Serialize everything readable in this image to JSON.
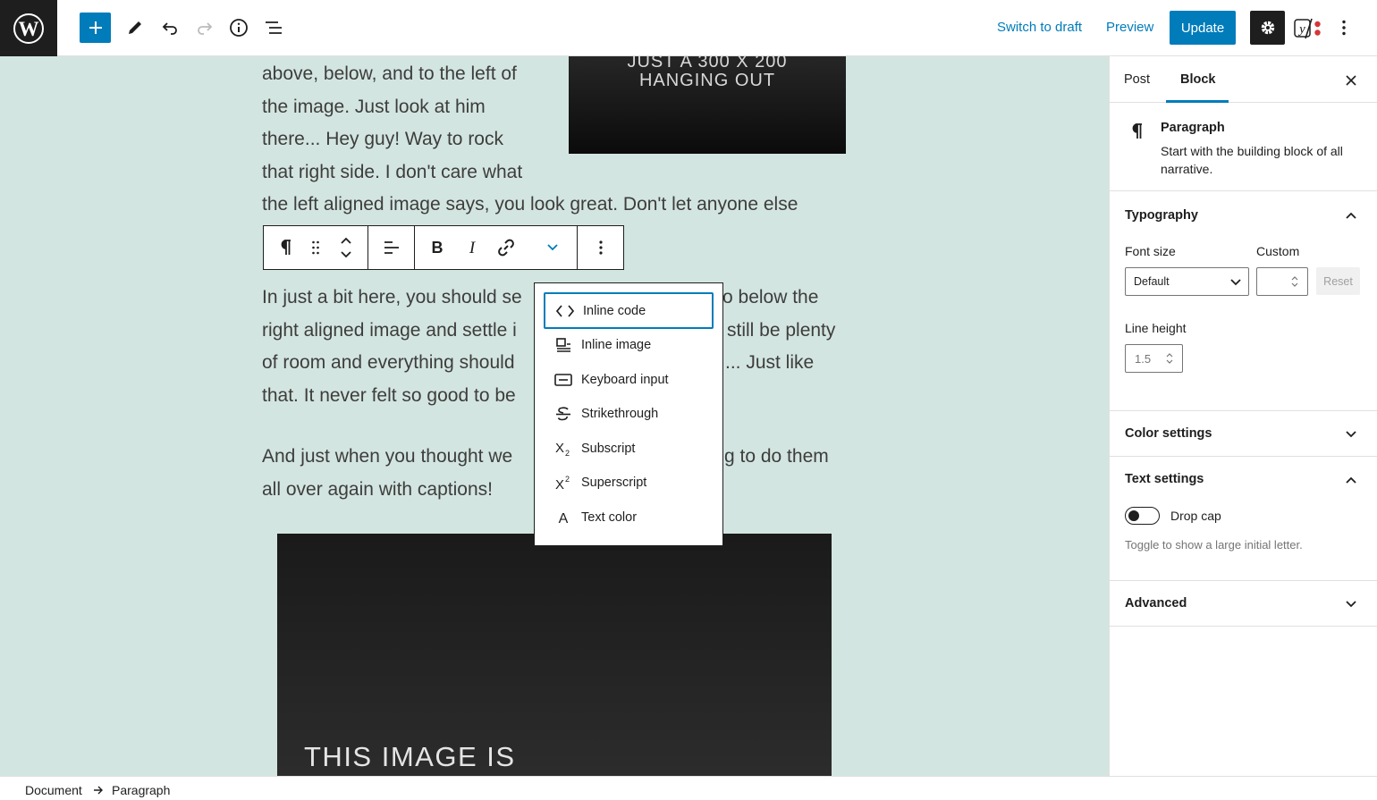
{
  "topbar": {
    "switch_to_draft": "Switch to draft",
    "preview": "Preview",
    "update": "Update",
    "yoast_letter": "y"
  },
  "content": {
    "lines_left_wrap": [
      "above, below, and to the left of",
      "the image. Just look at him",
      "there... Hey guy! Way to rock",
      "that right side. I don't care what"
    ],
    "line_full": "the left aligned image says, you look great. Don't let anyone else",
    "para2_left": [
      "In just a bit here, you should se",
      "right aligned image and settle i",
      "of room and everything should",
      "that. It never felt so good to be"
    ],
    "para2_right": [
      "o below the",
      "still be plenty",
      "... Just like",
      ""
    ],
    "para3_left": [
      "And just when you thought we",
      "all over again with captions!"
    ],
    "para3_right": [
      "g to do them",
      ""
    ],
    "image_top_caption_line1": "JUST A 300 X 200",
    "image_top_caption_line2": "HANGING OUT",
    "image_bottom_caption": "THIS IMAGE IS"
  },
  "format_menu": {
    "items": [
      {
        "label": "Inline code",
        "icon": "code-icon"
      },
      {
        "label": "Inline image",
        "icon": "inline-image-icon"
      },
      {
        "label": "Keyboard input",
        "icon": "keyboard-icon"
      },
      {
        "label": "Strikethrough",
        "icon": "strikethrough-icon"
      },
      {
        "label": "Subscript",
        "icon": "subscript-icon"
      },
      {
        "label": "Superscript",
        "icon": "superscript-icon"
      },
      {
        "label": "Text color",
        "icon": "text-color-icon"
      }
    ],
    "active_index": 0
  },
  "sidebar": {
    "tabs": [
      "Post",
      "Block"
    ],
    "active_tab": "Block",
    "block_card": {
      "title": "Paragraph",
      "description_line1": "Start with the building block of all",
      "description_line2": "narrative."
    },
    "typography": {
      "title": "Typography",
      "font_size_label": "Font size",
      "custom_label": "Custom",
      "font_size_value": "Default",
      "reset_label": "Reset",
      "line_height_label": "Line height",
      "line_height_value": "1.5"
    },
    "color_settings": "Color settings",
    "text_settings": {
      "title": "Text settings",
      "drop_cap_label": "Drop cap",
      "drop_cap_help": "Toggle to show a large initial letter.",
      "drop_cap_on": false
    },
    "advanced": "Advanced"
  },
  "footer": {
    "breadcrumbs": [
      "Document",
      "Paragraph"
    ]
  },
  "colors": {
    "accent": "#007cba",
    "canvas_bg": "#d3e5e0",
    "dark": "#1e1e1e",
    "yoast_dot": "#d63638"
  }
}
